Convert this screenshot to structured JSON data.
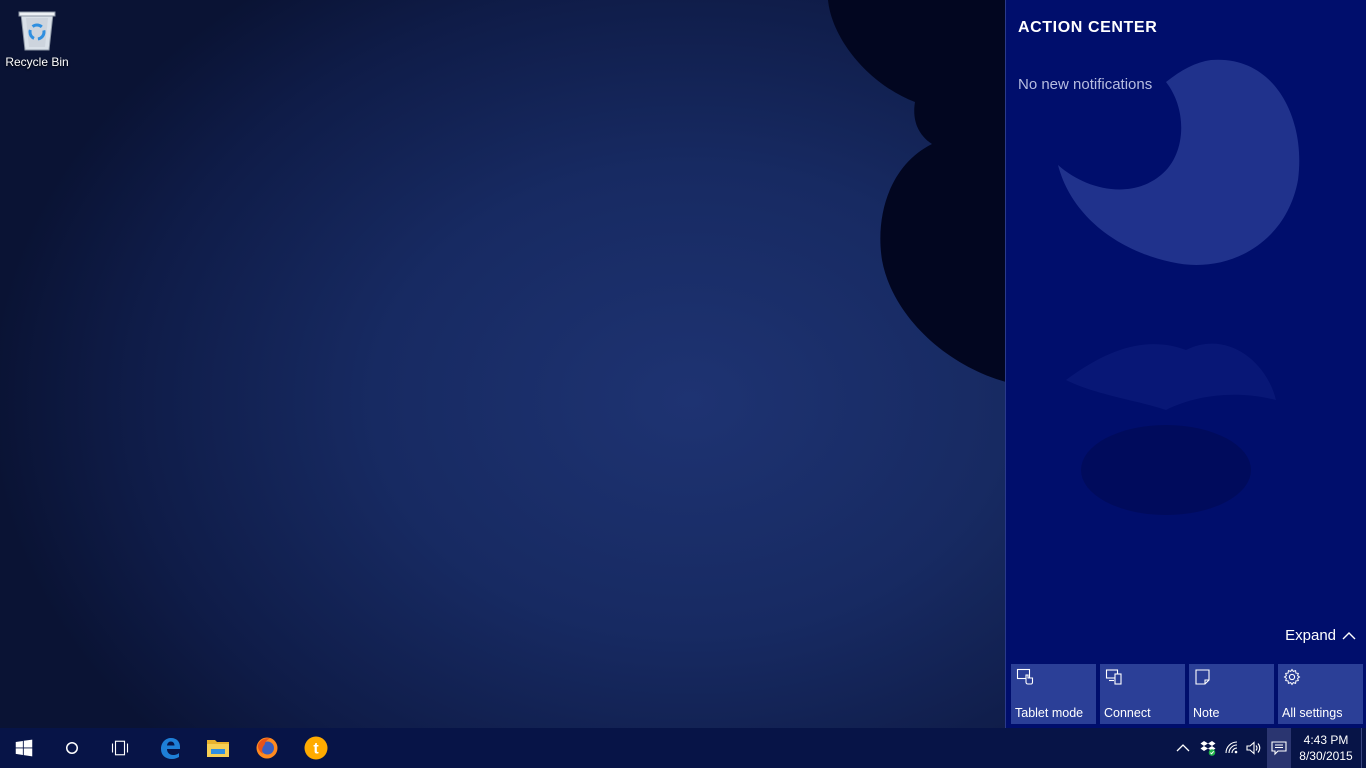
{
  "desktop": {
    "icons": [
      {
        "label": "Recycle Bin",
        "icon": "recycle-bin-icon"
      }
    ]
  },
  "action_center": {
    "title": "ACTION CENTER",
    "empty_message": "No new notifications",
    "expand_label": "Expand",
    "quick_actions": [
      {
        "label": "Tablet mode",
        "icon": "tablet-mode-icon"
      },
      {
        "label": "Connect",
        "icon": "connect-icon"
      },
      {
        "label": "Note",
        "icon": "note-icon"
      },
      {
        "label": "All settings",
        "icon": "gear-icon"
      }
    ]
  },
  "taskbar": {
    "buttons": [
      {
        "icon": "windows-start-icon"
      },
      {
        "icon": "cortana-search-icon"
      },
      {
        "icon": "task-view-icon"
      },
      {
        "icon": "edge-browser-icon"
      },
      {
        "icon": "file-explorer-icon"
      },
      {
        "icon": "firefox-icon"
      },
      {
        "icon": "orange-app-icon",
        "glyph": "t"
      }
    ],
    "tray": {
      "icons": [
        "show-hidden-icons-chevron-icon",
        "dropbox-icon",
        "wifi-icon",
        "volume-icon",
        "action-center-notification-icon"
      ],
      "time": "4:43 PM",
      "date": "8/30/2015"
    }
  },
  "colors": {
    "action_center_bg": "#000e6c",
    "tile_bg": "#2b3f97",
    "taskbar_bg": "#071447",
    "edge_blue": "#1e7fd7",
    "firefox_orange": "#ff8a1f",
    "app_orange": "#ffab00"
  }
}
